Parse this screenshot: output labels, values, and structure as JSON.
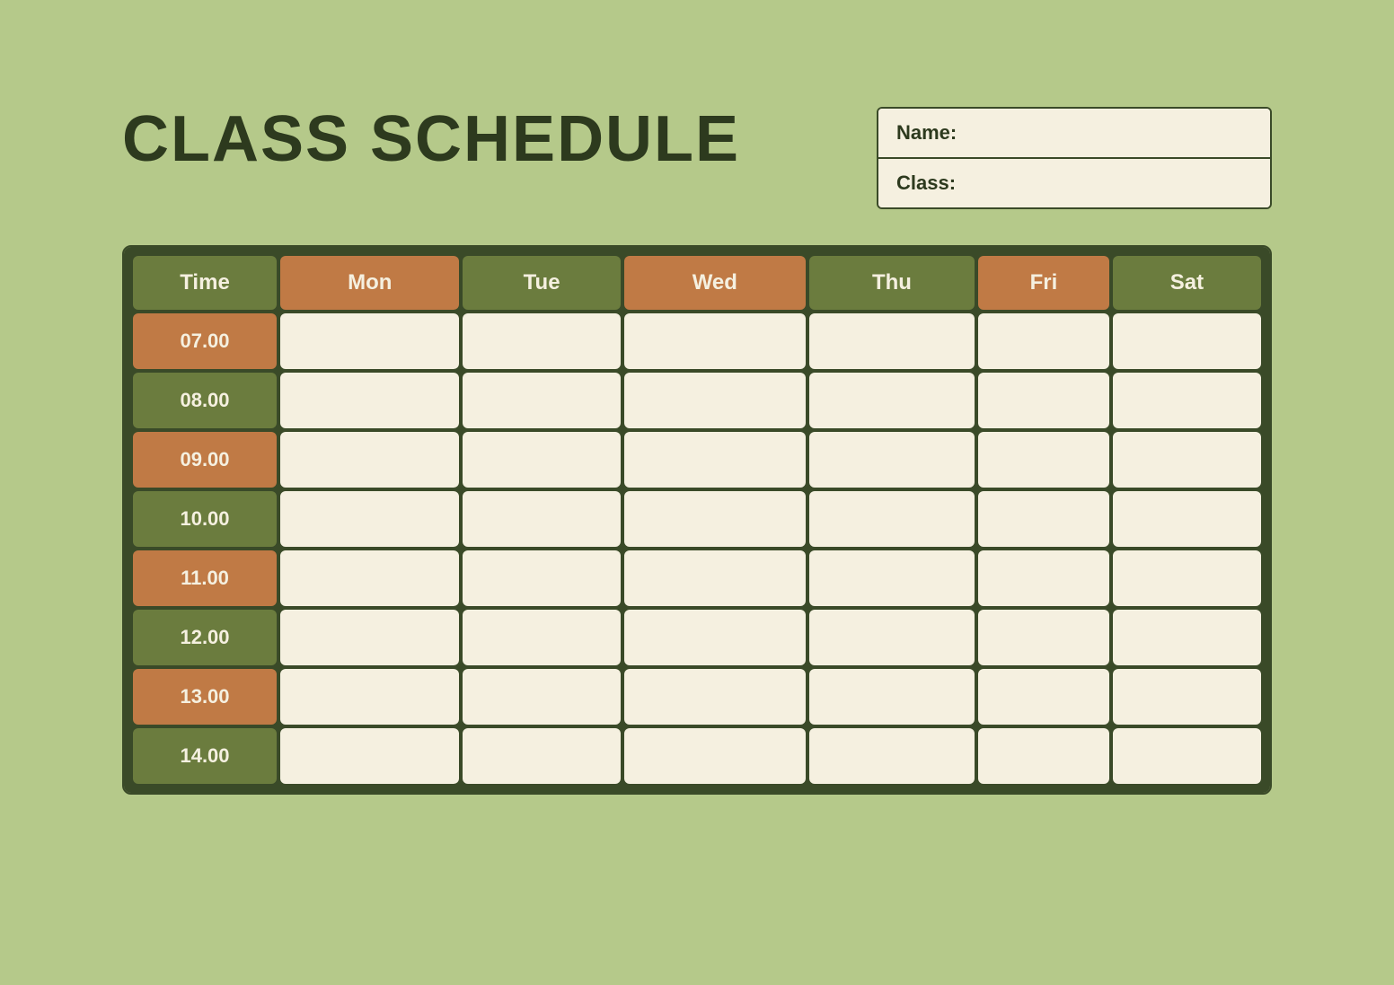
{
  "page": {
    "bg_color": "#b5c98a"
  },
  "title": "CLASS SCHEDULE",
  "info": {
    "name_label": "Name:",
    "class_label": "Class:"
  },
  "table": {
    "headers": [
      {
        "label": "Time",
        "type": "time"
      },
      {
        "label": "Mon",
        "type": "orange"
      },
      {
        "label": "Tue",
        "type": "green"
      },
      {
        "label": "Wed",
        "type": "orange"
      },
      {
        "label": "Thu",
        "type": "green"
      },
      {
        "label": "Fri",
        "type": "orange"
      },
      {
        "label": "Sat",
        "type": "green"
      }
    ],
    "rows": [
      {
        "time": "07.00",
        "time_type": "orange"
      },
      {
        "time": "08.00",
        "time_type": "green"
      },
      {
        "time": "09.00",
        "time_type": "orange"
      },
      {
        "time": "10.00",
        "time_type": "green"
      },
      {
        "time": "11.00",
        "time_type": "orange"
      },
      {
        "time": "12.00",
        "time_type": "green"
      },
      {
        "time": "13.00",
        "time_type": "orange"
      },
      {
        "time": "14.00",
        "time_type": "green"
      }
    ]
  }
}
